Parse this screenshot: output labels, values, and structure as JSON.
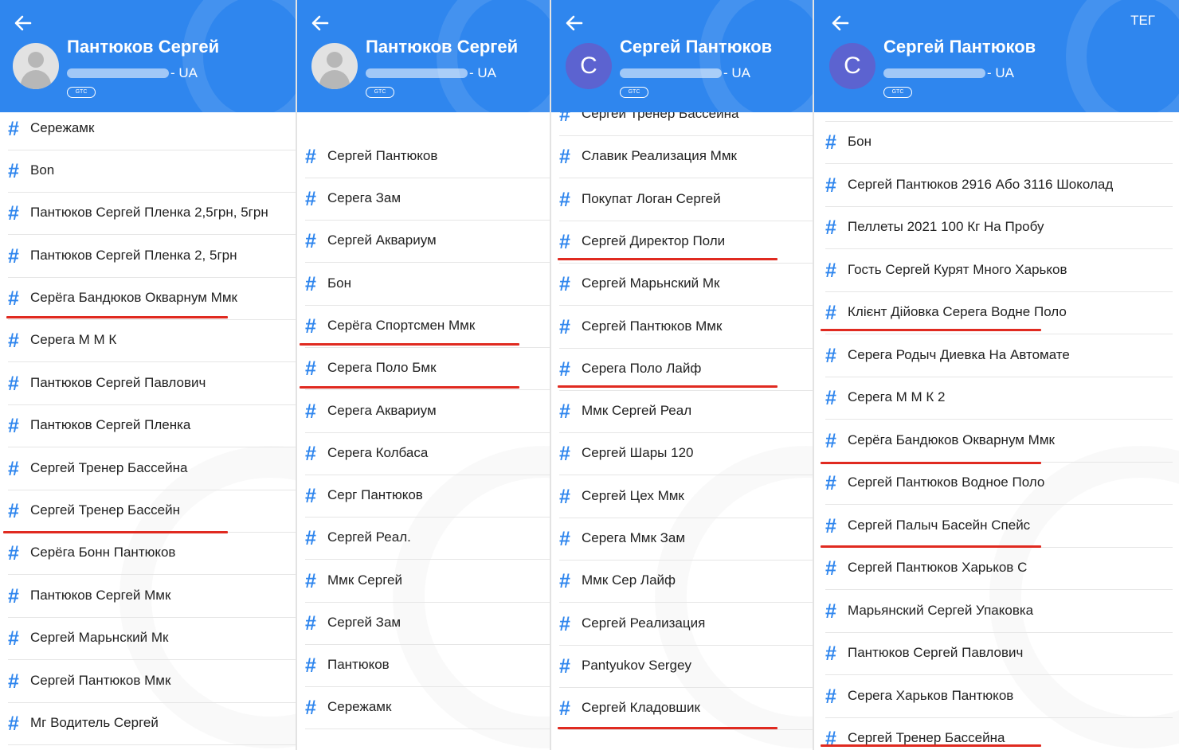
{
  "panels": [
    {
      "header": {
        "name": "Пантюков Сергей",
        "phone_suffix": "- UA",
        "badge": "GTC",
        "avatar_letter": "",
        "extra": ""
      },
      "items": [
        "Сережамк",
        "Bon",
        "Пантюков Сергей Пленка 2,5грн, 5грн",
        "Пантюков Сергей Пленка 2, 5грн",
        "Серёга Бандюков Окварнум Ммк",
        "Серега М М К",
        "Пантюков Сергей Павлович",
        "Пантюков Сергей Пленка",
        "Сергей Тренер Бассейна",
        "Сергей Тренер Бассейн",
        "Серёга Бонн Пантюков",
        "Пантюков Сергей Ммк",
        "Сергей Марьнский Мк",
        "Сергей Пантюков Ммк",
        "Мг Водитель Сергей"
      ]
    },
    {
      "header": {
        "name": "Пантюков Сергей",
        "phone_suffix": "- UA",
        "badge": "GTC",
        "avatar_letter": "",
        "extra": ""
      },
      "items": [
        "Сергей Пантюков",
        "Серега Зам",
        "Сергей Аквариум",
        "Бон",
        "Серёга Спортсмен Ммк",
        "Серега Поло Бмк",
        "Серега Аквариум",
        "Серега Колбаса",
        "Серг Пантюков",
        "Сергей Реал.",
        "Ммк Сергей",
        "Сергей Зам",
        "Пантюков",
        "Сережамк"
      ]
    },
    {
      "header": {
        "name": "Сергей Пантюков",
        "phone_suffix": "- UA",
        "badge": "GTC",
        "avatar_letter": "С",
        "extra": ""
      },
      "items": [
        "Сергей Тренер Бассейна",
        "Славик Реализация Ммк",
        "Покупат Логан Сергей",
        "Сергей Директор Поли",
        "Сергей Марьнский Мк",
        "Сергей Пантюков Ммк",
        "Серега Поло Лайф",
        "Ммк Сергей Реал",
        "Сергей Шары 120",
        "Сергей Цех Ммк",
        "Серега Ммк Зам",
        "Ммк Сер Лайф",
        "Сергей Реализация",
        "Pantyukov Sergey",
        "Сергей Кладовшик"
      ]
    },
    {
      "header": {
        "name": "Сергей Пантюков",
        "phone_suffix": "- UA",
        "badge": "GTC",
        "avatar_letter": "С",
        "extra": "ТЕГ"
      },
      "items": [
        "Бон",
        "Сергей Пантюков 2916 Або 3116 Шоколад",
        "Пеллеты 2021 100 Кг На Пробу",
        "Гость Сергей Курят Много Харьков",
        "Клієнт Дійовка Серега Водне Поло",
        "Серега Родыч Диевка На Автомате",
        "Серега М М К 2",
        "Серёга Бандюков Окварнум Ммк",
        "Сергей Пантюков Водное Поло",
        "Сергей Палыч Басейн Спейс",
        "Сергей Пантюков Харьков С",
        "Марьянский Сергей Упаковка",
        "Пантюков Сергей Павлович",
        "Серега Харьков Пантюков",
        "Сергей Тренер Бассейна"
      ]
    }
  ],
  "colors": {
    "header": "#2f86ee",
    "hash": "#2f86ee",
    "underline": "#e02a20",
    "avatar_letter_bg": "#5c63d0"
  }
}
